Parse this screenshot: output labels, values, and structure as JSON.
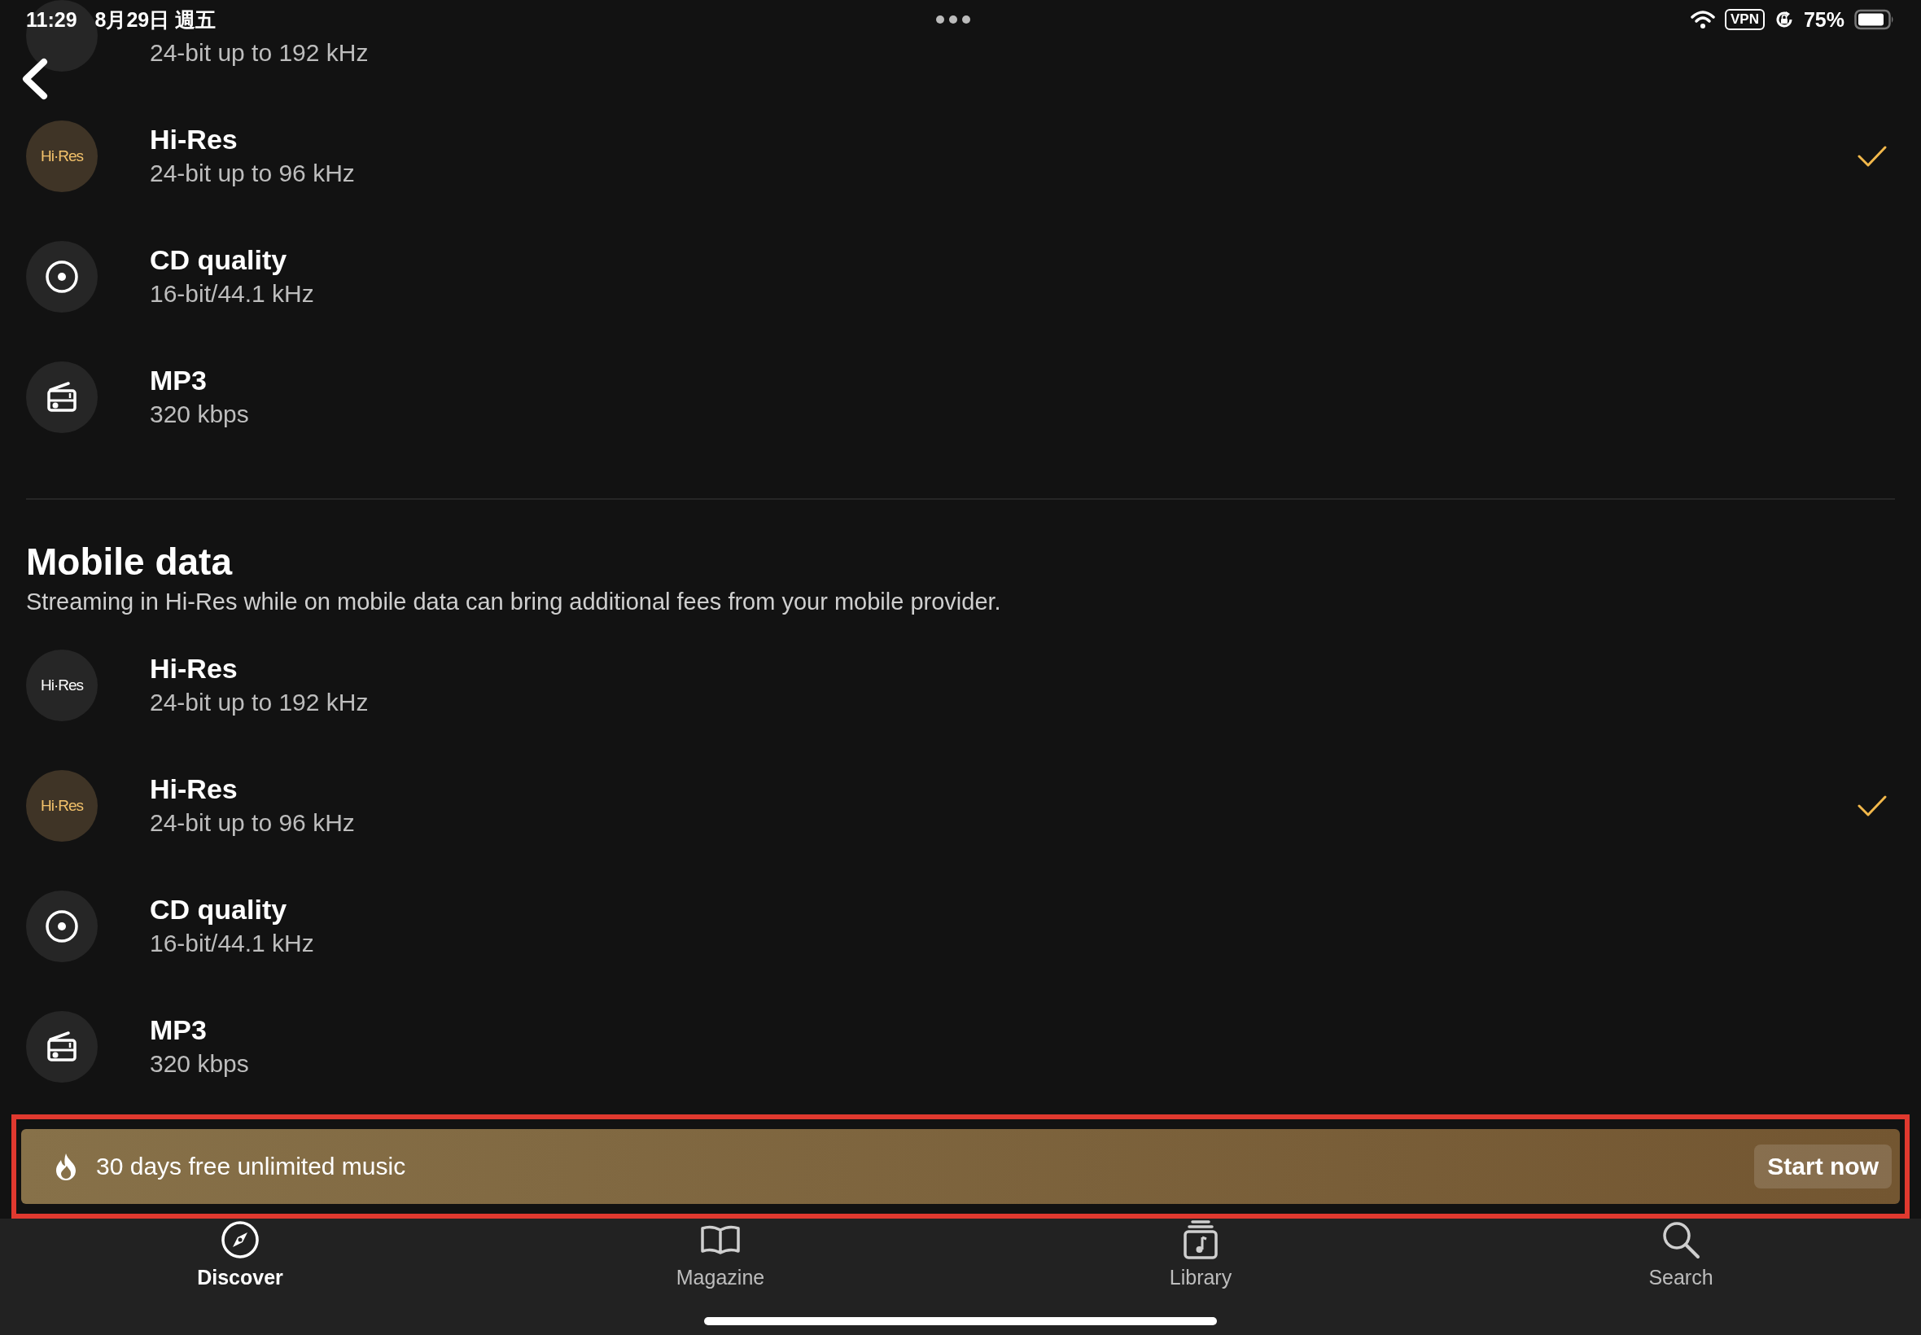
{
  "status_bar": {
    "time": "11:29",
    "date": "8月29日 週五",
    "vpn": "VPN",
    "battery": "75%"
  },
  "sections": [
    {
      "items": [
        {
          "kind": "hires",
          "subtitle": "24-bit up to 192 kHz",
          "selected": false
        },
        {
          "kind": "hires",
          "badge": "Hi·Res",
          "title": "Hi-Res",
          "subtitle": "24-bit up to 96 kHz",
          "selected": true
        },
        {
          "kind": "cd",
          "title": "CD quality",
          "subtitle": "16-bit/44.1 kHz",
          "selected": false
        },
        {
          "kind": "mp3",
          "title": "MP3",
          "subtitle": "320 kbps",
          "selected": false
        }
      ]
    },
    {
      "title": "Mobile data",
      "description": "Streaming in Hi-Res while on mobile data can bring additional fees from your mobile provider.",
      "items": [
        {
          "kind": "hires",
          "badge": "Hi·Res",
          "title": "Hi-Res",
          "subtitle": "24-bit up to 192 kHz",
          "selected": false
        },
        {
          "kind": "hires",
          "badge": "Hi·Res",
          "title": "Hi-Res",
          "subtitle": "24-bit up to 96 kHz",
          "selected": true
        },
        {
          "kind": "cd",
          "title": "CD quality",
          "subtitle": "16-bit/44.1 kHz",
          "selected": false
        },
        {
          "kind": "mp3",
          "title": "MP3",
          "subtitle": "320 kbps",
          "selected": false
        }
      ]
    }
  ],
  "banner": {
    "text": "30 days free unlimited music",
    "button": "Start now",
    "highlighted": true
  },
  "tab_bar": [
    {
      "kind": "discover",
      "label": "Discover",
      "selected": true
    },
    {
      "kind": "magazine",
      "label": "Magazine",
      "selected": false
    },
    {
      "kind": "library",
      "label": "Library",
      "selected": false
    },
    {
      "kind": "search",
      "label": "Search",
      "selected": false
    }
  ]
}
